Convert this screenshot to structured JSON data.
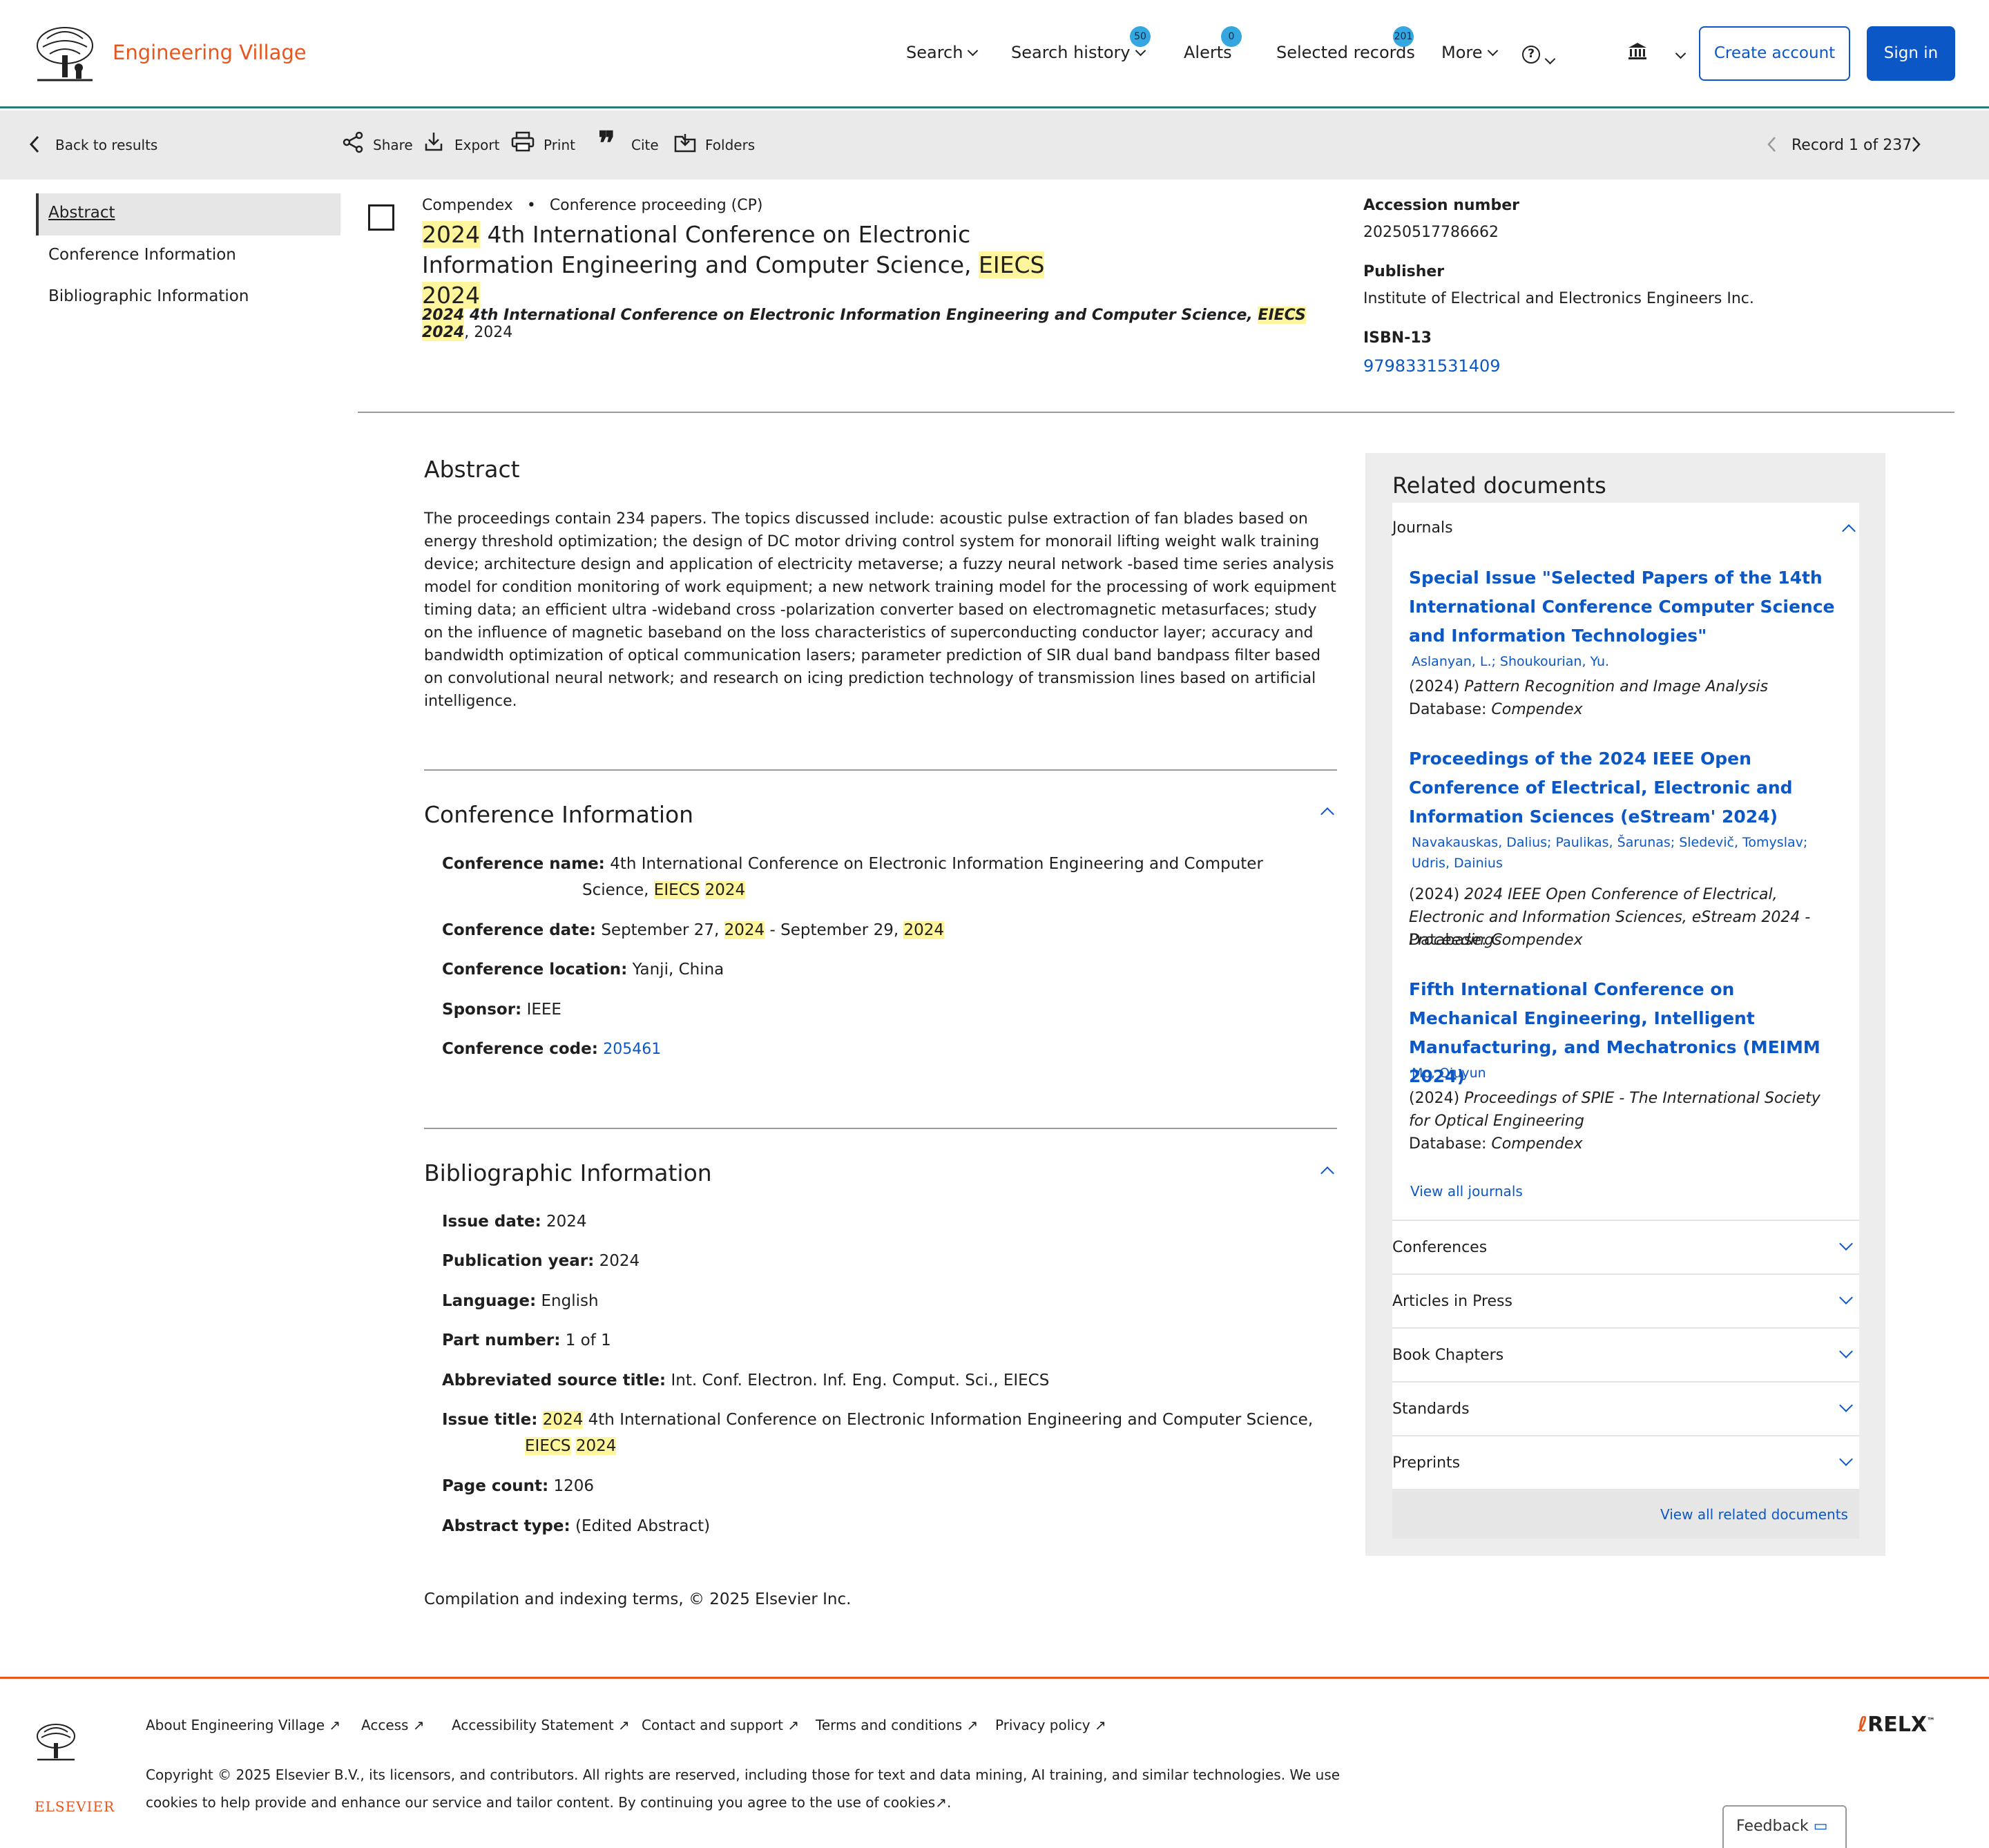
{
  "header": {
    "brand": "Engineering Village",
    "nav": [
      "Search",
      "Search history",
      "Alerts",
      "Selected records",
      "More"
    ],
    "badges": {
      "search_history": "50",
      "alerts": "0",
      "selected_records": "201"
    },
    "create_account": "Create account",
    "sign_in": "Sign in"
  },
  "toolbar": {
    "back": "Back to results",
    "share": "Share",
    "export": "Export",
    "print": "Print",
    "cite": "Cite",
    "folders": "Folders",
    "record_pos": "Record 1 of 237"
  },
  "sidenav": [
    "Abstract",
    "Conference Information",
    "Bibliographic Information"
  ],
  "record": {
    "database": "Compendex",
    "doc_type": "Conference proceeding (CP)",
    "title_year": "2024",
    "title_mid": " 4th International Conference on Electronic Information Engineering and Computer Science, ",
    "title_acr": "EIECS",
    "title_year2": "2024",
    "subtitle_mid": " 4th International Conference on Electronic Information Engineering and Computer Science, ",
    "subtitle_acr": "EIECS",
    "subtitle_tail": ", 2024"
  },
  "side_meta": {
    "accession_label": "Accession number",
    "accession": "20250517786662",
    "publisher_label": "Publisher",
    "publisher": "Institute of Electrical and Electronics Engineers Inc.",
    "isbn_label": "ISBN-13",
    "isbn": "9798331531409"
  },
  "abstract": {
    "heading": "Abstract",
    "text": "The proceedings contain 234 papers. The topics discussed include: acoustic pulse extraction of fan blades based on energy threshold optimization; the design of DC motor driving control system for monorail lifting weight walk training device; architecture design and application of electricity metaverse; a fuzzy neural network -based time series analysis model for condition monitoring of work equipment; a new network training model for the processing of work equipment timing data; an efficient ultra -wideband cross -polarization converter based on electromagnetic metasurfaces; study on the influence of magnetic baseband on the loss characteristics of superconducting conductor layer; accuracy and bandwidth optimization of optical communication lasers; parameter prediction of SIR dual band bandpass filter based on convolutional neural network; and research on icing prediction technology of transmission lines based on artificial intelligence."
  },
  "conference": {
    "heading": "Conference Information",
    "name_label": "Conference name:",
    "name_mid": "4th International Conference on Electronic Information Engineering and Computer Science, ",
    "name_acr": "EIECS",
    "name_year": "2024",
    "date_label": "Conference date:",
    "date_a": "September 27, ",
    "date_y1": "2024",
    "date_b": " - September 29, ",
    "date_y2": "2024",
    "location_label": "Conference location:",
    "location": "Yanji, China",
    "sponsor_label": "Sponsor:",
    "sponsor": "IEEE",
    "code_label": "Conference code:",
    "code": "205461"
  },
  "biblio": {
    "heading": "Bibliographic Information",
    "fields": [
      {
        "label": "Issue date:",
        "value": "2024"
      },
      {
        "label": "Publication year:",
        "value": "2024"
      },
      {
        "label": "Language:",
        "value": "English"
      },
      {
        "label": "Part number:",
        "value": "1 of 1"
      },
      {
        "label": "Abbreviated source title:",
        "value": "Int. Conf. Electron. Inf. Eng. Comput. Sci., EIECS"
      }
    ],
    "issue_label": "Issue title:",
    "issue_year": "2024",
    "issue_mid": " 4th International Conference on Electronic Information Engineering and Computer Science, ",
    "issue_acr": "EIECS",
    "issue_year2": "2024",
    "page_count_label": "Page count:",
    "page_count": "1206",
    "abstract_type_label": "Abstract type:",
    "abstract_type": "(Edited Abstract)"
  },
  "compilation": "Compilation and indexing terms, © 2025 Elsevier Inc.",
  "related": {
    "heading": "Related documents",
    "journals_label": "Journals",
    "items": [
      {
        "title": "Special Issue \"Selected Papers of the 14th International Conference Computer Science and Information Technologies\"",
        "authors": "Aslanyan, L.; Shoukourian, Yu.",
        "year": "(2024)",
        "source": "Pattern Recognition and Image Analysis",
        "db_label": "Database:",
        "db": "Compendex"
      },
      {
        "title": "Proceedings of the 2024 IEEE Open Conference of Electrical, Electronic and Information Sciences (eStream' 2024)",
        "authors": "Navakauskas, Dalius; Paulikas, Šarunas; Sledevič, Tomyslav; Udris, Dainius",
        "year": "(2024)",
        "source": "2024 IEEE Open Conference of Electrical, Electronic and Information Sciences, eStream 2024 - Proceedings",
        "db_label": "Database:",
        "db": "Compendex"
      },
      {
        "title": "Fifth International Conference on Mechanical Engineering, Intelligent Manufacturing, and Mechatronics (MEIMM 2024)",
        "authors": "Mo, Qiuyun",
        "year": "(2024)",
        "source": "Proceedings of SPIE - The International Society for Optical Engineering",
        "db_label": "Database:",
        "db": "Compendex"
      }
    ],
    "view_all_journals": "View all journals",
    "sections": [
      "Conferences",
      "Articles in Press",
      "Book Chapters",
      "Standards",
      "Preprints"
    ],
    "view_all": "View all related documents"
  },
  "footer": {
    "links": [
      "About Engineering Village",
      "Access",
      "Accessibility Statement",
      "Contact and support",
      "Terms and conditions",
      "Privacy policy"
    ],
    "copyright": "Copyright © 2025 Elsevier B.V., its licensors, and contributors. All rights are reserved, including those for text and data mining, AI training, and similar technologies. We use cookies to help provide and enhance our service and tailor content. By continuing you agree to the use of cookies",
    "elsevier": "ELSEVIER",
    "relx": "RELX",
    "feedback": "Feedback"
  }
}
